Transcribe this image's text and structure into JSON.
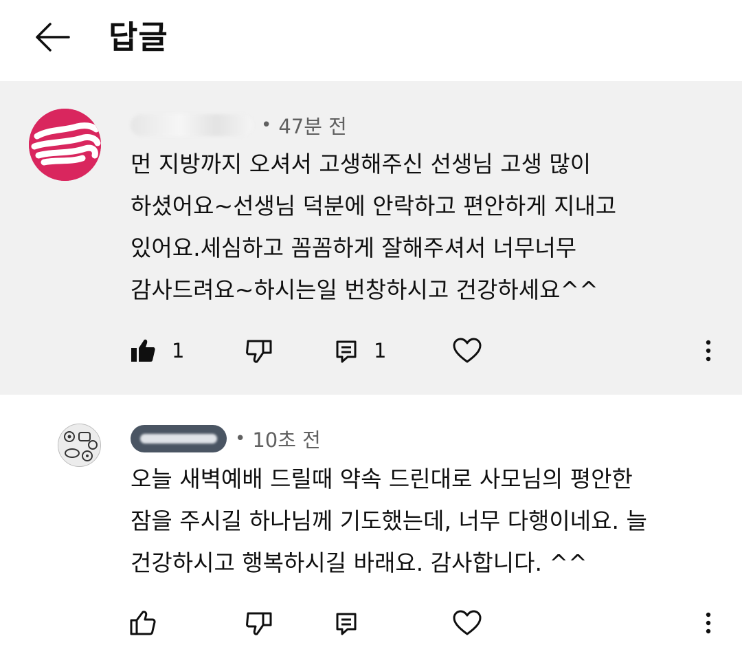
{
  "header": {
    "title": "답글"
  },
  "parent_comment": {
    "time": "47분 전",
    "dot": "•",
    "text": "먼 지방까지 오셔서 고생해주신 선생님 고생 많이\n하셨어요~선생님 덕분에 안락하고 편안하게 지내고\n있어요.세심하고 꼼꼼하게 잘해주셔서 너무너무\n감사드려요~하시는일 번창하시고 건강하세요^^",
    "like_count": "1",
    "reply_count": "1",
    "avatar_color": "#d9265e"
  },
  "reply_comment": {
    "time": "10초 전",
    "dot": "•",
    "text": "오늘 새벽예배 드릴때 약속 드린대로 사모님의 평안한\n잠을 주시길 하나님께 기도했는데, 너무 다행이네요. 늘\n건강하시고 행복하시길 바래요. 감사합니다. ^^",
    "author_badge_color": "#4a5563"
  },
  "icons": {
    "back": "back-arrow-icon",
    "like_filled": "thumbs-up-filled-icon",
    "like_outline": "thumbs-up-outline-icon",
    "dislike": "thumbs-down-icon",
    "reply": "reply-icon",
    "heart": "heart-icon",
    "more": "more-vertical-icon"
  }
}
